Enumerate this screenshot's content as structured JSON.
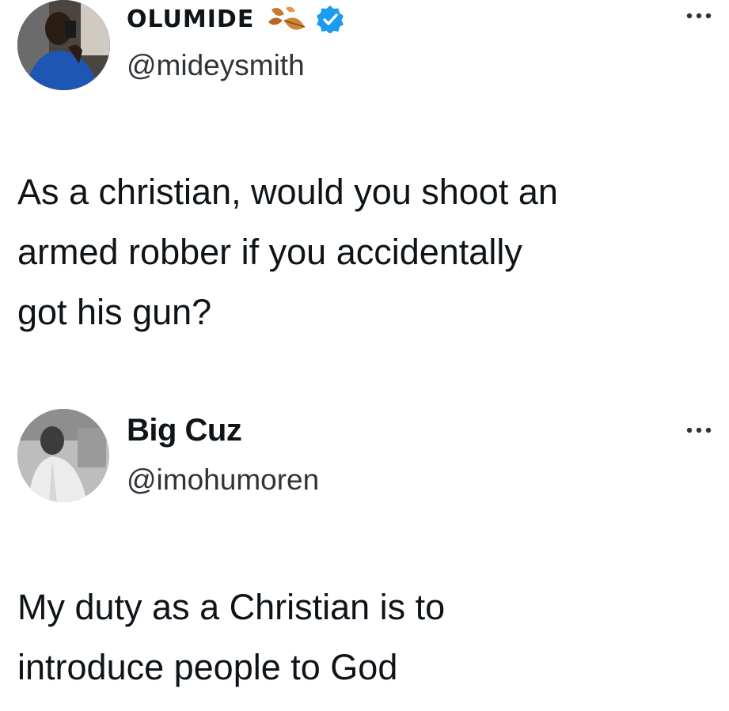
{
  "tweets": [
    {
      "author": {
        "display_name": "OLUMIDE",
        "handle": "@mideysmith",
        "avatar_icon": "profile-photo",
        "badges": [
          "leaf-emoji-icon",
          "verified-badge-icon"
        ],
        "verified_color": "#1d9bf0"
      },
      "text_lines": [
        "As a christian, would you shoot an",
        "armed robber if you accidentally",
        "got his gun?"
      ],
      "more_icon": "more-options-icon"
    },
    {
      "author": {
        "display_name": "Big Cuz",
        "handle": "@imohumoren",
        "avatar_icon": "profile-photo"
      },
      "text_lines": [
        "My duty as a Christian is to",
        "introduce people to God"
      ],
      "more_icon": "more-options-icon"
    }
  ],
  "colors": {
    "text": "#0f1419",
    "handle": "#2f3439",
    "background": "#ffffff",
    "verified": "#1d9bf0",
    "leaf": "#c77a2c"
  }
}
